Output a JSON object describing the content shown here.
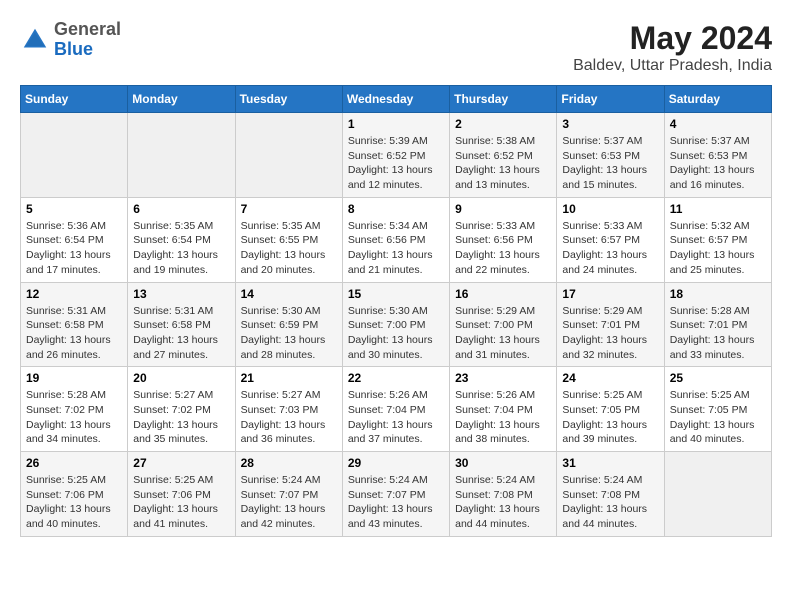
{
  "header": {
    "logo": {
      "line1": "General",
      "line2": "Blue"
    },
    "title": "May 2024",
    "location": "Baldev, Uttar Pradesh, India"
  },
  "weekdays": [
    "Sunday",
    "Monday",
    "Tuesday",
    "Wednesday",
    "Thursday",
    "Friday",
    "Saturday"
  ],
  "weeks": [
    [
      {
        "day": "",
        "info": ""
      },
      {
        "day": "",
        "info": ""
      },
      {
        "day": "",
        "info": ""
      },
      {
        "day": "1",
        "info": "Sunrise: 5:39 AM\nSunset: 6:52 PM\nDaylight: 13 hours\nand 12 minutes."
      },
      {
        "day": "2",
        "info": "Sunrise: 5:38 AM\nSunset: 6:52 PM\nDaylight: 13 hours\nand 13 minutes."
      },
      {
        "day": "3",
        "info": "Sunrise: 5:37 AM\nSunset: 6:53 PM\nDaylight: 13 hours\nand 15 minutes."
      },
      {
        "day": "4",
        "info": "Sunrise: 5:37 AM\nSunset: 6:53 PM\nDaylight: 13 hours\nand 16 minutes."
      }
    ],
    [
      {
        "day": "5",
        "info": "Sunrise: 5:36 AM\nSunset: 6:54 PM\nDaylight: 13 hours\nand 17 minutes."
      },
      {
        "day": "6",
        "info": "Sunrise: 5:35 AM\nSunset: 6:54 PM\nDaylight: 13 hours\nand 19 minutes."
      },
      {
        "day": "7",
        "info": "Sunrise: 5:35 AM\nSunset: 6:55 PM\nDaylight: 13 hours\nand 20 minutes."
      },
      {
        "day": "8",
        "info": "Sunrise: 5:34 AM\nSunset: 6:56 PM\nDaylight: 13 hours\nand 21 minutes."
      },
      {
        "day": "9",
        "info": "Sunrise: 5:33 AM\nSunset: 6:56 PM\nDaylight: 13 hours\nand 22 minutes."
      },
      {
        "day": "10",
        "info": "Sunrise: 5:33 AM\nSunset: 6:57 PM\nDaylight: 13 hours\nand 24 minutes."
      },
      {
        "day": "11",
        "info": "Sunrise: 5:32 AM\nSunset: 6:57 PM\nDaylight: 13 hours\nand 25 minutes."
      }
    ],
    [
      {
        "day": "12",
        "info": "Sunrise: 5:31 AM\nSunset: 6:58 PM\nDaylight: 13 hours\nand 26 minutes."
      },
      {
        "day": "13",
        "info": "Sunrise: 5:31 AM\nSunset: 6:58 PM\nDaylight: 13 hours\nand 27 minutes."
      },
      {
        "day": "14",
        "info": "Sunrise: 5:30 AM\nSunset: 6:59 PM\nDaylight: 13 hours\nand 28 minutes."
      },
      {
        "day": "15",
        "info": "Sunrise: 5:30 AM\nSunset: 7:00 PM\nDaylight: 13 hours\nand 30 minutes."
      },
      {
        "day": "16",
        "info": "Sunrise: 5:29 AM\nSunset: 7:00 PM\nDaylight: 13 hours\nand 31 minutes."
      },
      {
        "day": "17",
        "info": "Sunrise: 5:29 AM\nSunset: 7:01 PM\nDaylight: 13 hours\nand 32 minutes."
      },
      {
        "day": "18",
        "info": "Sunrise: 5:28 AM\nSunset: 7:01 PM\nDaylight: 13 hours\nand 33 minutes."
      }
    ],
    [
      {
        "day": "19",
        "info": "Sunrise: 5:28 AM\nSunset: 7:02 PM\nDaylight: 13 hours\nand 34 minutes."
      },
      {
        "day": "20",
        "info": "Sunrise: 5:27 AM\nSunset: 7:02 PM\nDaylight: 13 hours\nand 35 minutes."
      },
      {
        "day": "21",
        "info": "Sunrise: 5:27 AM\nSunset: 7:03 PM\nDaylight: 13 hours\nand 36 minutes."
      },
      {
        "day": "22",
        "info": "Sunrise: 5:26 AM\nSunset: 7:04 PM\nDaylight: 13 hours\nand 37 minutes."
      },
      {
        "day": "23",
        "info": "Sunrise: 5:26 AM\nSunset: 7:04 PM\nDaylight: 13 hours\nand 38 minutes."
      },
      {
        "day": "24",
        "info": "Sunrise: 5:25 AM\nSunset: 7:05 PM\nDaylight: 13 hours\nand 39 minutes."
      },
      {
        "day": "25",
        "info": "Sunrise: 5:25 AM\nSunset: 7:05 PM\nDaylight: 13 hours\nand 40 minutes."
      }
    ],
    [
      {
        "day": "26",
        "info": "Sunrise: 5:25 AM\nSunset: 7:06 PM\nDaylight: 13 hours\nand 40 minutes."
      },
      {
        "day": "27",
        "info": "Sunrise: 5:25 AM\nSunset: 7:06 PM\nDaylight: 13 hours\nand 41 minutes."
      },
      {
        "day": "28",
        "info": "Sunrise: 5:24 AM\nSunset: 7:07 PM\nDaylight: 13 hours\nand 42 minutes."
      },
      {
        "day": "29",
        "info": "Sunrise: 5:24 AM\nSunset: 7:07 PM\nDaylight: 13 hours\nand 43 minutes."
      },
      {
        "day": "30",
        "info": "Sunrise: 5:24 AM\nSunset: 7:08 PM\nDaylight: 13 hours\nand 44 minutes."
      },
      {
        "day": "31",
        "info": "Sunrise: 5:24 AM\nSunset: 7:08 PM\nDaylight: 13 hours\nand 44 minutes."
      },
      {
        "day": "",
        "info": ""
      }
    ]
  ]
}
